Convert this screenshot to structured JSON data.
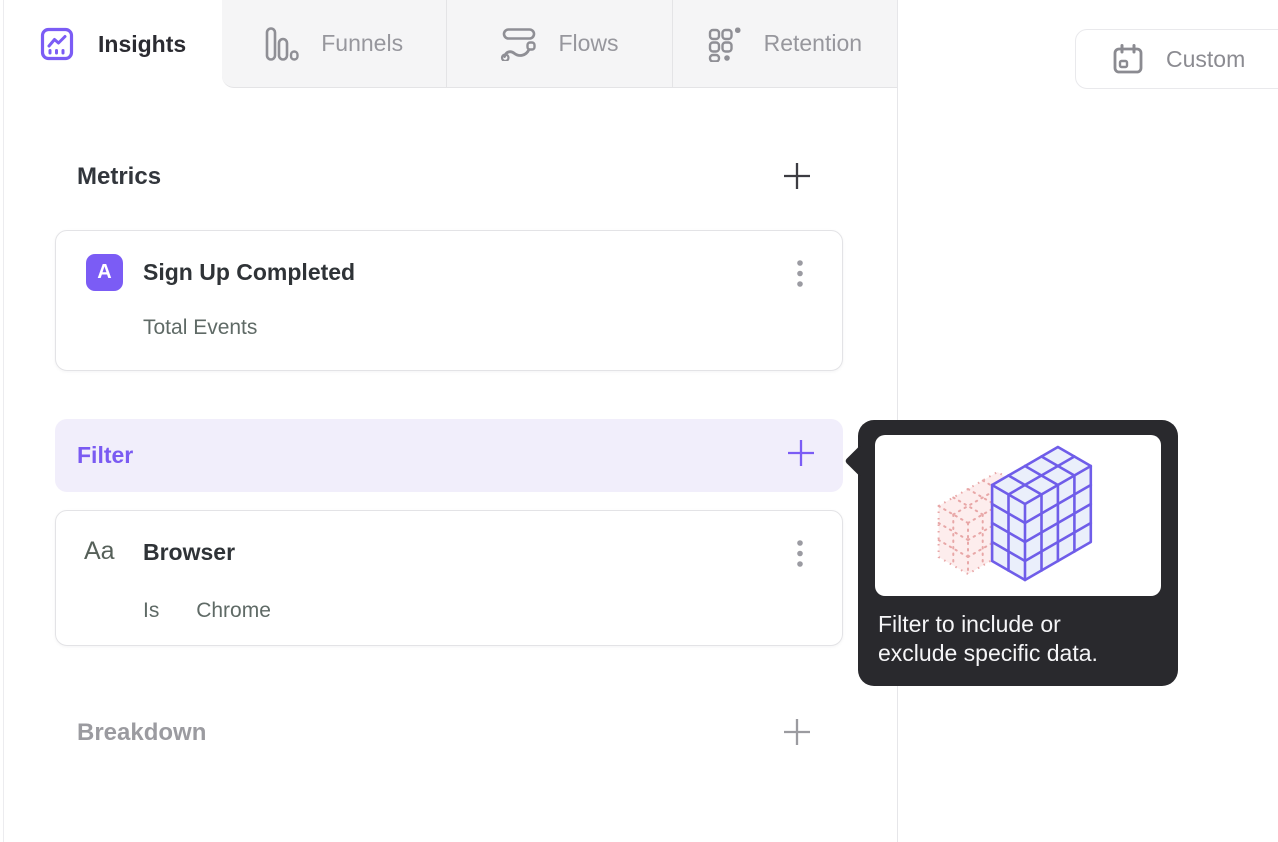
{
  "tabs": {
    "items": [
      {
        "label": "Insights",
        "icon": "insights-icon",
        "active": true
      },
      {
        "label": "Funnels",
        "icon": "funnels-icon",
        "active": false
      },
      {
        "label": "Flows",
        "icon": "flows-icon",
        "active": false
      },
      {
        "label": "Retention",
        "icon": "retention-icon",
        "active": false
      }
    ]
  },
  "toolbar": {
    "date_range_label": "Custom",
    "date_range_icon": "calendar-icon"
  },
  "builder": {
    "metrics_section": {
      "title": "Metrics",
      "add_icon": "plus-icon"
    },
    "metric_card": {
      "badge_label": "A",
      "event_name": "Sign Up Completed",
      "measurement": "Total Events",
      "menu_icon": "kebab-menu-icon"
    },
    "filter_section": {
      "title": "Filter",
      "add_icon": "plus-icon"
    },
    "filter_card": {
      "type_icon_label": "Aa",
      "property_name": "Browser",
      "operator": "Is",
      "value": "Chrome",
      "menu_icon": "kebab-menu-icon"
    },
    "breakdown_section": {
      "title": "Breakdown",
      "add_icon": "plus-icon"
    }
  },
  "tooltip": {
    "text": "Filter to include or exclude specific data.",
    "illustration": "filter-cube-illustration"
  },
  "colors": {
    "accent_purple": "#7b5cf5",
    "filter_row_bg": "#f1eefb",
    "filter_text": "#7a5af2",
    "tooltip_bg": "#29292d",
    "inactive_tab_bg": "#f5f5f6",
    "muted_gray": "#97979d",
    "subtext_gray": "#5f6a66",
    "illustration_pink": "#e8a7a7",
    "illustration_blue_fill": "#eaeffb"
  }
}
